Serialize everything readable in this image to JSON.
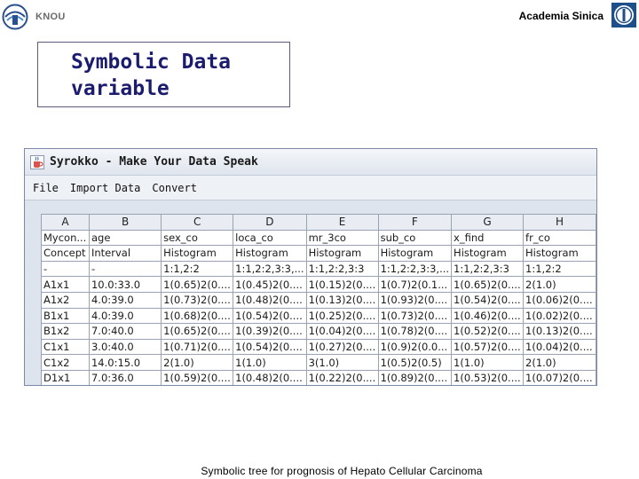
{
  "header": {
    "left_logo_text": "KNOU",
    "org_name": "Academia Sinica"
  },
  "slide_title": {
    "line1": "Symbolic Data",
    "line2": "variable"
  },
  "app": {
    "title": "Syrokko - Make Your Data Speak",
    "menu": [
      "File",
      "Import Data",
      "Convert"
    ],
    "columns": [
      "A",
      "B",
      "C",
      "D",
      "E",
      "F",
      "G",
      "H"
    ],
    "rows": [
      [
        "Mycon...",
        "age",
        "sex_co",
        "loca_co",
        "mr_3co",
        "sub_co",
        "x_find",
        "fr_co"
      ],
      [
        "Concept",
        "Interval",
        "Histogram",
        "Histogram",
        "Histogram",
        "Histogram",
        "Histogram",
        "Histogram"
      ],
      [
        "-",
        "-",
        "1:1,2:2",
        "1:1,2:2,3:3,...",
        "1:1,2:2,3:3",
        "1:1,2:2,3:3,...",
        "1:1,2:2,3:3",
        "1:1,2:2"
      ],
      [
        "A1x1",
        "10.0:33.0",
        "1(0.65)2(0....",
        "1(0.45)2(0....",
        "1(0.15)2(0....",
        "1(0.7)2(0.1...",
        "1(0.65)2(0....",
        "2(1.0)"
      ],
      [
        "A1x2",
        "4.0:39.0",
        "1(0.73)2(0....",
        "1(0.48)2(0....",
        "1(0.13)2(0....",
        "1(0.93)2(0....",
        "1(0.54)2(0....",
        "1(0.06)2(0...."
      ],
      [
        "B1x1",
        "4.0:39.0",
        "1(0.68)2(0....",
        "1(0.54)2(0....",
        "1(0.25)2(0....",
        "1(0.73)2(0....",
        "1(0.46)2(0....",
        "1(0.02)2(0...."
      ],
      [
        "B1x2",
        "7.0:40.0",
        "1(0.65)2(0....",
        "1(0.39)2(0....",
        "1(0.04)2(0....",
        "1(0.78)2(0....",
        "1(0.52)2(0....",
        "1(0.13)2(0...."
      ],
      [
        "C1x1",
        "3.0:40.0",
        "1(0.71)2(0....",
        "1(0.54)2(0....",
        "1(0.27)2(0....",
        "1(0.9)2(0.0...",
        "1(0.57)2(0....",
        "1(0.04)2(0...."
      ],
      [
        "C1x2",
        "14.0:15.0",
        "2(1.0)",
        "1(1.0)",
        "3(1.0)",
        "1(0.5)2(0.5)",
        "1(1.0)",
        "2(1.0)"
      ],
      [
        "D1x1",
        "7.0:36.0",
        "1(0.59)2(0....",
        "1(0.48)2(0....",
        "1(0.22)2(0....",
        "1(0.89)2(0....",
        "1(0.53)2(0....",
        "1(0.07)2(0...."
      ]
    ]
  },
  "caption": "Symbolic tree for prognosis of Hepato Cellular Carcinoma",
  "colors": {
    "title_text": "#1c1c6e",
    "window_bg": "#dde4ee",
    "grid_border": "#9aa3b2"
  },
  "icons": {
    "left_logo": "knou-emblem-icon",
    "right_logo": "academia-sinica-emblem-icon",
    "app_icon": "java-cup-icon"
  }
}
